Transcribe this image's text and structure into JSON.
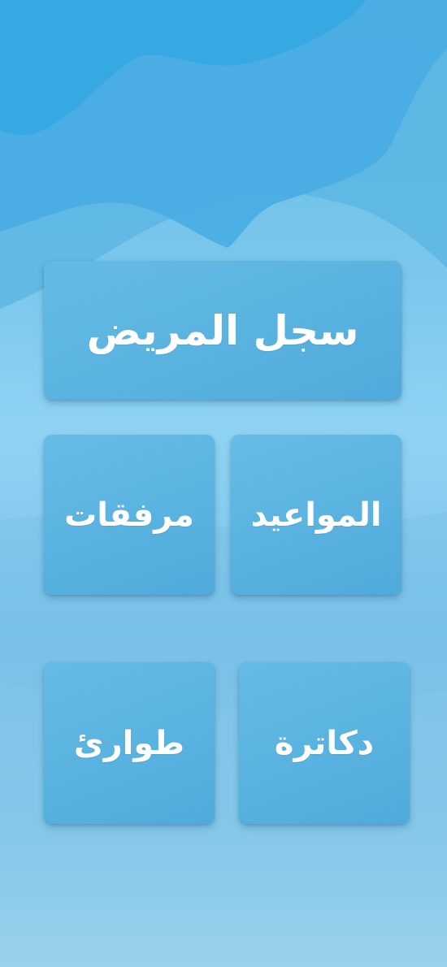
{
  "colors": {
    "background_top": "#2fa6e0",
    "background_mid": "#8fd3f3",
    "background_bottom": "#bfe2f2",
    "tile": "#5bb3e2",
    "label": "#ffffff"
  },
  "menu": {
    "patient_record": "سجل المريض",
    "appointments": "المواعيد",
    "attachments": "مرفقات",
    "doctors": "دكاترة",
    "emergency": "طوارئ"
  }
}
